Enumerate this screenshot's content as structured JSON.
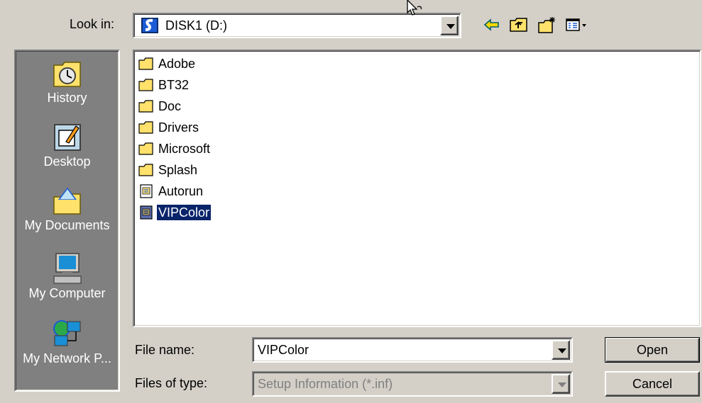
{
  "look_in": {
    "label": "Look in:",
    "value": "DISK1 (D:)"
  },
  "toolbar": {
    "icons": [
      "back-arrow-icon",
      "up-one-level-icon",
      "create-new-folder-icon",
      "view-menu-icon"
    ]
  },
  "places": [
    {
      "label": "History",
      "icon": "history-icon"
    },
    {
      "label": "Desktop",
      "icon": "desktop-icon"
    },
    {
      "label": "My Documents",
      "icon": "my-documents-icon"
    },
    {
      "label": "My Computer",
      "icon": "my-computer-icon"
    },
    {
      "label": "My Network P...",
      "icon": "my-network-places-icon"
    }
  ],
  "files": [
    {
      "name": "Adobe",
      "type": "folder"
    },
    {
      "name": "BT32",
      "type": "folder"
    },
    {
      "name": "Doc",
      "type": "folder"
    },
    {
      "name": "Drivers",
      "type": "folder"
    },
    {
      "name": "Microsoft",
      "type": "folder"
    },
    {
      "name": "Splash",
      "type": "folder"
    },
    {
      "name": "Autorun",
      "type": "setup-information"
    },
    {
      "name": "VIPColor",
      "type": "setup-information",
      "selected": true
    }
  ],
  "file_name": {
    "label": "File name:",
    "value": "VIPColor"
  },
  "file_type": {
    "label": "Files of type:",
    "value": "Setup Information (*.inf)"
  },
  "buttons": {
    "open": "Open",
    "cancel": "Cancel"
  },
  "colors": {
    "dialog_bg": "#d4d0c8",
    "places_bg": "#808080",
    "selection": "#0a246a",
    "folder": "#ffe16b"
  }
}
